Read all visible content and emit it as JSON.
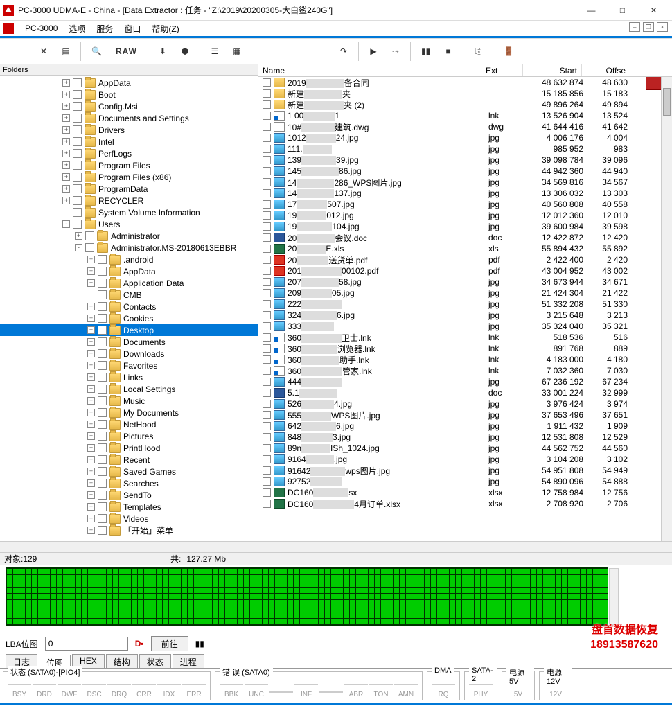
{
  "title": "PC-3000 UDMA-E - China - [Data Extractor : 任务 - \"Z:\\2019\\20200305-大白鲨240G\"]",
  "menu": {
    "app": "PC-3000",
    "items": [
      "选项",
      "服务",
      "窗口",
      "帮助(Z)"
    ]
  },
  "toolbar": {
    "raw": "RAW"
  },
  "folders_label": "Folders",
  "tree": [
    {
      "d": 5,
      "e": "+",
      "n": "AppData"
    },
    {
      "d": 5,
      "e": "+",
      "n": "Boot"
    },
    {
      "d": 5,
      "e": "+",
      "n": "Config.Msi"
    },
    {
      "d": 5,
      "e": "+",
      "n": "Documents and Settings"
    },
    {
      "d": 5,
      "e": "+",
      "n": "Drivers"
    },
    {
      "d": 5,
      "e": "+",
      "n": "Intel"
    },
    {
      "d": 5,
      "e": "+",
      "n": "PerfLogs"
    },
    {
      "d": 5,
      "e": "+",
      "n": "Program Files"
    },
    {
      "d": 5,
      "e": "+",
      "n": "Program Files (x86)"
    },
    {
      "d": 5,
      "e": "+",
      "n": "ProgramData"
    },
    {
      "d": 5,
      "e": "+",
      "n": "RECYCLER"
    },
    {
      "d": 5,
      "e": " ",
      "n": "System Volume Information"
    },
    {
      "d": 5,
      "e": "-",
      "n": "Users"
    },
    {
      "d": 6,
      "e": "+",
      "n": "Administrator"
    },
    {
      "d": 6,
      "e": "-",
      "n": "Administrator.MS-20180613EBBR"
    },
    {
      "d": 7,
      "e": "+",
      "n": ".android"
    },
    {
      "d": 7,
      "e": "+",
      "n": "AppData"
    },
    {
      "d": 7,
      "e": "+",
      "n": "Application Data"
    },
    {
      "d": 7,
      "e": " ",
      "n": "CMB"
    },
    {
      "d": 7,
      "e": "+",
      "n": "Contacts"
    },
    {
      "d": 7,
      "e": "+",
      "n": "Cookies"
    },
    {
      "d": 7,
      "e": "+",
      "n": "Desktop",
      "sel": true
    },
    {
      "d": 7,
      "e": "+",
      "n": "Documents"
    },
    {
      "d": 7,
      "e": "+",
      "n": "Downloads"
    },
    {
      "d": 7,
      "e": "+",
      "n": "Favorites"
    },
    {
      "d": 7,
      "e": "+",
      "n": "Links"
    },
    {
      "d": 7,
      "e": "+",
      "n": "Local Settings"
    },
    {
      "d": 7,
      "e": "+",
      "n": "Music"
    },
    {
      "d": 7,
      "e": "+",
      "n": "My Documents"
    },
    {
      "d": 7,
      "e": "+",
      "n": "NetHood"
    },
    {
      "d": 7,
      "e": "+",
      "n": "Pictures"
    },
    {
      "d": 7,
      "e": "+",
      "n": "PrintHood"
    },
    {
      "d": 7,
      "e": "+",
      "n": "Recent"
    },
    {
      "d": 7,
      "e": "+",
      "n": "Saved Games"
    },
    {
      "d": 7,
      "e": "+",
      "n": "Searches"
    },
    {
      "d": 7,
      "e": "+",
      "n": "SendTo"
    },
    {
      "d": 7,
      "e": "+",
      "n": "Templates"
    },
    {
      "d": 7,
      "e": "+",
      "n": "Videos"
    },
    {
      "d": 7,
      "e": "+",
      "n": "「开始」菜单"
    }
  ],
  "file_cols": {
    "name": "Name",
    "ext": "Ext",
    "start": "Start",
    "offset": "Offse"
  },
  "files": [
    {
      "ic": "folder",
      "p": "2019",
      "s": "备合同",
      "ext": "",
      "start": "48 632 874",
      "off": "48 630"
    },
    {
      "ic": "folder",
      "p": "新建",
      "s": "夹",
      "ext": "",
      "start": "15 185 856",
      "off": "15 183"
    },
    {
      "ic": "folder",
      "p": "新建",
      "s": "夹 (2)",
      "ext": "",
      "start": "49 896 264",
      "off": "49 894"
    },
    {
      "ic": "lnk",
      "p": "1 00",
      "s": "1",
      "ext": "lnk",
      "start": "13 526 904",
      "off": "13 524"
    },
    {
      "ic": "txt",
      "p": "10#",
      "s": "建筑.dwg",
      "ext": "dwg",
      "start": "41 644 416",
      "off": "41 642"
    },
    {
      "ic": "img",
      "p": "1012",
      "s": "24.jpg",
      "ext": "jpg",
      "start": "4 006 176",
      "off": "4 004"
    },
    {
      "ic": "img",
      "p": "111.",
      "s": "",
      "ext": "jpg",
      "start": "985 952",
      "off": "983"
    },
    {
      "ic": "img",
      "p": "139",
      "s": "39.jpg",
      "ext": "jpg",
      "start": "39 098 784",
      "off": "39 096"
    },
    {
      "ic": "img",
      "p": "145",
      "s": "86.jpg",
      "ext": "jpg",
      "start": "44 942 360",
      "off": "44 940"
    },
    {
      "ic": "img",
      "p": "14",
      "s": "286_WPS图片.jpg",
      "ext": "jpg",
      "start": "34 569 816",
      "off": "34 567"
    },
    {
      "ic": "img",
      "p": "14",
      "s": "137.jpg",
      "ext": "jpg",
      "start": "13 306 032",
      "off": "13 303"
    },
    {
      "ic": "img",
      "p": "17",
      "s": "507.jpg",
      "ext": "jpg",
      "start": "40 560 808",
      "off": "40 558"
    },
    {
      "ic": "img",
      "p": "19",
      "s": "012.jpg",
      "ext": "jpg",
      "start": "12 012 360",
      "off": "12 010"
    },
    {
      "ic": "img",
      "p": "19",
      "s": "104.jpg",
      "ext": "jpg",
      "start": "39 600 984",
      "off": "39 598"
    },
    {
      "ic": "doc",
      "p": "20",
      "s": "会议.doc",
      "ext": "doc",
      "start": "12 422 872",
      "off": "12 420"
    },
    {
      "ic": "xls",
      "p": "20",
      "s": "E.xls",
      "ext": "xls",
      "start": "55 894 432",
      "off": "55 892"
    },
    {
      "ic": "pdf",
      "p": "20",
      "s": "送货单.pdf",
      "ext": "pdf",
      "start": "2 422 400",
      "off": "2 420"
    },
    {
      "ic": "pdf",
      "p": "201",
      "s": "00102.pdf",
      "ext": "pdf",
      "start": "43 004 952",
      "off": "43 002"
    },
    {
      "ic": "img",
      "p": "207",
      "s": "58.jpg",
      "ext": "jpg",
      "start": "34 673 944",
      "off": "34 671"
    },
    {
      "ic": "img",
      "p": "209",
      "s": "05.jpg",
      "ext": "jpg",
      "start": "21 424 304",
      "off": "21 422"
    },
    {
      "ic": "img",
      "p": "222",
      "s": "",
      "ext": "jpg",
      "start": "51 332 208",
      "off": "51 330"
    },
    {
      "ic": "img",
      "p": "324",
      "s": "6.jpg",
      "ext": "jpg",
      "start": "3 215 648",
      "off": "3 213"
    },
    {
      "ic": "img",
      "p": "333",
      "s": "",
      "ext": "jpg",
      "start": "35 324 040",
      "off": "35 321"
    },
    {
      "ic": "lnk",
      "p": "360",
      "s": "卫士.lnk",
      "ext": "lnk",
      "start": "518 536",
      "off": "516"
    },
    {
      "ic": "lnk",
      "p": "360",
      "s": "浏览器.lnk",
      "ext": "lnk",
      "start": "891 768",
      "off": "889"
    },
    {
      "ic": "lnk",
      "p": "360",
      "s": "助手.lnk",
      "ext": "lnk",
      "start": "4 183 000",
      "off": "4 180"
    },
    {
      "ic": "lnk",
      "p": "360",
      "s": "管家.lnk",
      "ext": "lnk",
      "start": "7 032 360",
      "off": "7 030"
    },
    {
      "ic": "img",
      "p": "444",
      "s": "",
      "ext": "jpg",
      "start": "67 236 192",
      "off": "67 234"
    },
    {
      "ic": "doc",
      "p": "5.1",
      "s": "",
      "ext": "doc",
      "start": "33 001 224",
      "off": "32 999"
    },
    {
      "ic": "img",
      "p": "526",
      "s": "4.jpg",
      "ext": "jpg",
      "start": "3 976 424",
      "off": "3 974"
    },
    {
      "ic": "img",
      "p": "555",
      "s": "WPS图片.jpg",
      "ext": "jpg",
      "start": "37 653 496",
      "off": "37 651"
    },
    {
      "ic": "img",
      "p": "642",
      "s": "6.jpg",
      "ext": "jpg",
      "start": "1 911 432",
      "off": "1 909"
    },
    {
      "ic": "img",
      "p": "848",
      "s": "3.jpg",
      "ext": "jpg",
      "start": "12 531 808",
      "off": "12 529"
    },
    {
      "ic": "img",
      "p": "89n",
      "s": "ISh_1024.jpg",
      "ext": "jpg",
      "start": "44 562 752",
      "off": "44 560"
    },
    {
      "ic": "img",
      "p": "9164",
      "s": ".jpg",
      "ext": "jpg",
      "start": "3 104 208",
      "off": "3 102"
    },
    {
      "ic": "img",
      "p": "91642",
      "s": "wps图片.jpg",
      "ext": "jpg",
      "start": "54 951 808",
      "off": "54 949"
    },
    {
      "ic": "img",
      "p": "92752",
      "s": "",
      "ext": "jpg",
      "start": "54 890 096",
      "off": "54 888"
    },
    {
      "ic": "xls",
      "p": "DC160",
      "s": "sx",
      "ext": "xlsx",
      "start": "12 758 984",
      "off": "12 756"
    },
    {
      "ic": "xls",
      "p": "DC160",
      "s": "4月订单.xlsx",
      "ext": "xlsx",
      "start": "2 708 920",
      "off": "2 706"
    }
  ],
  "status": {
    "objects": "对象:129",
    "total_lbl": "共:",
    "total_val": "127.27 Mb"
  },
  "lba": {
    "label": "LBA位图",
    "value": "0",
    "goto": "前往"
  },
  "watermark": {
    "line1": "盘首数据恢复",
    "line2": "18913587620"
  },
  "tabs": [
    "日志",
    "位图",
    "HEX",
    "结构",
    "状态",
    "进程"
  ],
  "active_tab": 1,
  "groups": {
    "g1": {
      "title": "状态 (SATA0)-[PIO4]",
      "cells": [
        "BSY",
        "DRD",
        "DWF",
        "DSC",
        "DRQ",
        "CRR",
        "IDX",
        "ERR"
      ]
    },
    "g2": {
      "title": "错 误 (SATA0)",
      "cells": [
        "BBK",
        "UNC",
        "",
        "INF",
        "",
        "ABR",
        "TON",
        "AMN"
      ]
    },
    "g3": {
      "title": "DMA",
      "cells": [
        "RQ"
      ]
    },
    "g4": {
      "title": "SATA-2",
      "cells": [
        "PHY"
      ]
    },
    "g5": {
      "title": "电源 5V",
      "cells": [
        "5V"
      ]
    },
    "g6": {
      "title": "电源 12V",
      "cells": [
        "12V"
      ]
    }
  }
}
